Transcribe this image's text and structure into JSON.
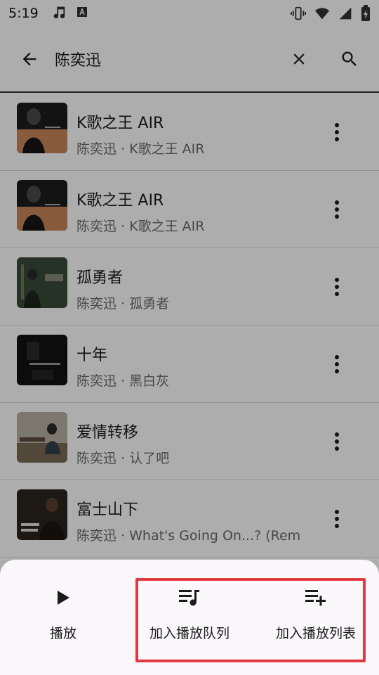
{
  "status": {
    "time": "5:19"
  },
  "search": {
    "query": "陈奕迅"
  },
  "songs": [
    {
      "title": "K歌之王 AIR",
      "subtitle": "陈奕迅 · K歌之王 AIR"
    },
    {
      "title": "K歌之王 AIR",
      "subtitle": "陈奕迅 · K歌之王 AIR"
    },
    {
      "title": "孤勇者",
      "subtitle": "陈奕迅 · 孤勇者"
    },
    {
      "title": "十年",
      "subtitle": "陈奕迅 · 黑白灰"
    },
    {
      "title": "爱情转移",
      "subtitle": "陈奕迅 · 认了吧"
    },
    {
      "title": "富士山下",
      "subtitle": "陈奕迅 · What's Going On...? (Rem"
    }
  ],
  "sheet": {
    "actions": [
      {
        "label": "播放",
        "icon": "play-icon"
      },
      {
        "label": "加入播放队列",
        "icon": "queue-music-icon"
      },
      {
        "label": "加入播放列表",
        "icon": "playlist-add-icon"
      }
    ]
  },
  "colors": {
    "highlight": "#e0393f",
    "scrim": "rgba(0,0,0,0.32)",
    "sheet_bg": "#fbf8fb"
  }
}
